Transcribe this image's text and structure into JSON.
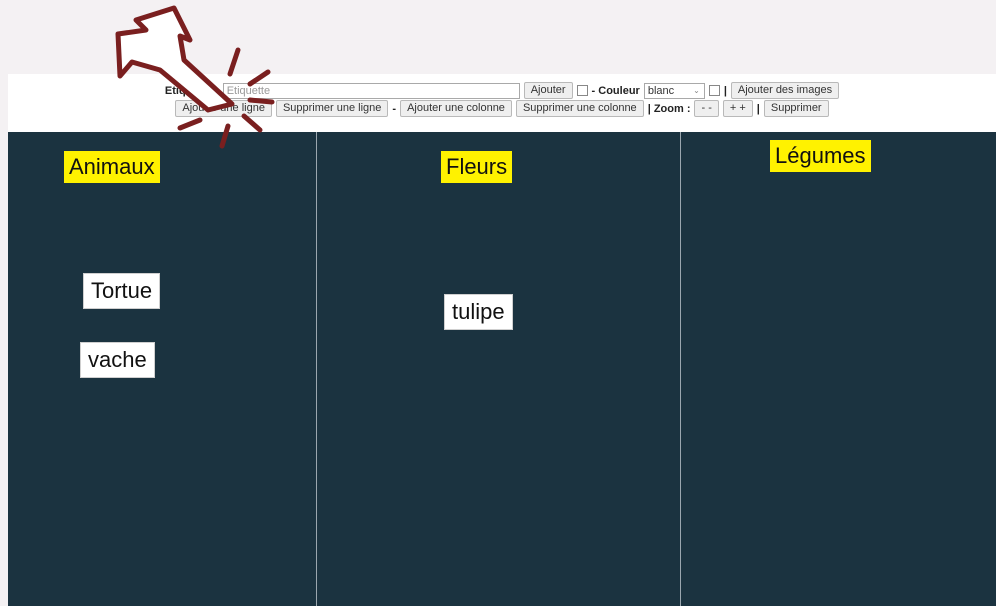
{
  "toolbar": {
    "etiquette_label": "Etiquette :",
    "etiquette_placeholder": "Etiquette",
    "add_button": "Ajouter",
    "color_label": "- Couleur",
    "color_value": "blanc",
    "add_images_button": "Ajouter des images",
    "add_row_button": "Ajouter une ligne",
    "delete_row_button": "Supprimer une ligne",
    "dash": "-",
    "add_column_button": "Ajouter une colonne",
    "delete_column_button": "Supprimer une colonne",
    "zoom_label": "| Zoom :",
    "zoom_out_button": "- -",
    "zoom_in_button": "+ +",
    "pipe": "|",
    "delete_button": "Supprimer"
  },
  "board": {
    "columns": [
      {
        "title": "Animaux",
        "tags": [
          "Tortue",
          "vache"
        ]
      },
      {
        "title": "Fleurs",
        "tags": [
          "tulipe"
        ]
      },
      {
        "title": "Légumes",
        "tags": []
      }
    ]
  },
  "colors": {
    "board_background": "#1b3340",
    "column_title_background": "#fff200",
    "annotation_arrow": "#7a1f1f"
  },
  "annotation": {
    "icon": "cursor-arrow-click-icon"
  }
}
